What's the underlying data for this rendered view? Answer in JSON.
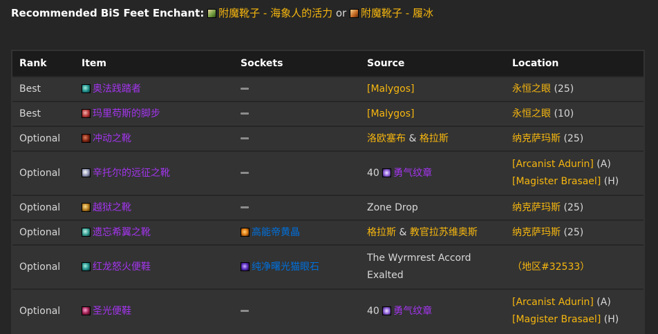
{
  "enchant": {
    "lead": "Recommended BiS Feet Enchant",
    "colon": ":",
    "option1": "附魔靴子 - 海象人的活力",
    "option1_icon": "scroll-icon",
    "or": "or",
    "option2": "附魔靴子 - 履冰",
    "option2_icon": "scroll-icon"
  },
  "table": {
    "headers": [
      "Rank",
      "Item",
      "Sockets",
      "Source",
      "Location"
    ],
    "rows": [
      {
        "rank": "Best",
        "item": "奥法践踏者",
        "sockets": "",
        "source": "[Malygos]",
        "location_name": "永恒之眼",
        "location_suffix": "(25)"
      },
      {
        "rank": "Best",
        "item": "玛里苟斯的脚步",
        "sockets": "",
        "source": "[Malygos]",
        "location_name": "永恒之眼",
        "location_suffix": "(10)"
      },
      {
        "rank": "Optional",
        "item": "冲动之靴",
        "sockets": "",
        "source_a": "洛欧塞布",
        "source_amp": "&",
        "source_b": "格拉斯",
        "location_name": "纳克萨玛斯",
        "location_suffix": "(25)"
      },
      {
        "rank": "Optional",
        "item": "辛托尔的远征之靴",
        "sockets": "",
        "source_count": "40",
        "source_badge": "勇气纹章",
        "location_vendor1": "[Arcanist Adurin]",
        "location_faction1": "(A)",
        "location_vendor2": "[Magister Brasael]",
        "location_faction2": "(H)"
      },
      {
        "rank": "Optional",
        "item": "越狱之靴",
        "sockets": "",
        "source": "Zone Drop",
        "location_name": "纳克萨玛斯",
        "location_suffix": "(25)"
      },
      {
        "rank": "Optional",
        "item": "遗忘希翼之靴",
        "socket_gem": "高能帝黄晶",
        "source_a": "格拉斯",
        "source_amp": "&",
        "source_b": "教官拉苏维奥斯",
        "location_name": "纳克萨玛斯",
        "location_suffix": "(25)"
      },
      {
        "rank": "Optional",
        "item": "红龙怒火便鞋",
        "socket_gem": "纯净曙光猫眼石",
        "source_line1": "The Wyrmrest Accord",
        "source_line2": "Exalted",
        "location_zone": "（地区#32533）"
      },
      {
        "rank": "Optional",
        "item": "圣光便鞋",
        "sockets": "",
        "source_count": "40",
        "source_badge": "勇气纹章",
        "location_vendor1": "[Arcanist Adurin]",
        "location_faction1": "(A)",
        "location_vendor2": "[Magister Brasael]",
        "location_faction2": "(H)"
      }
    ]
  },
  "colors": {
    "gold": "#f7b70f",
    "epic": "#a335ee",
    "rare": "#0070dd",
    "background": "#262626"
  }
}
